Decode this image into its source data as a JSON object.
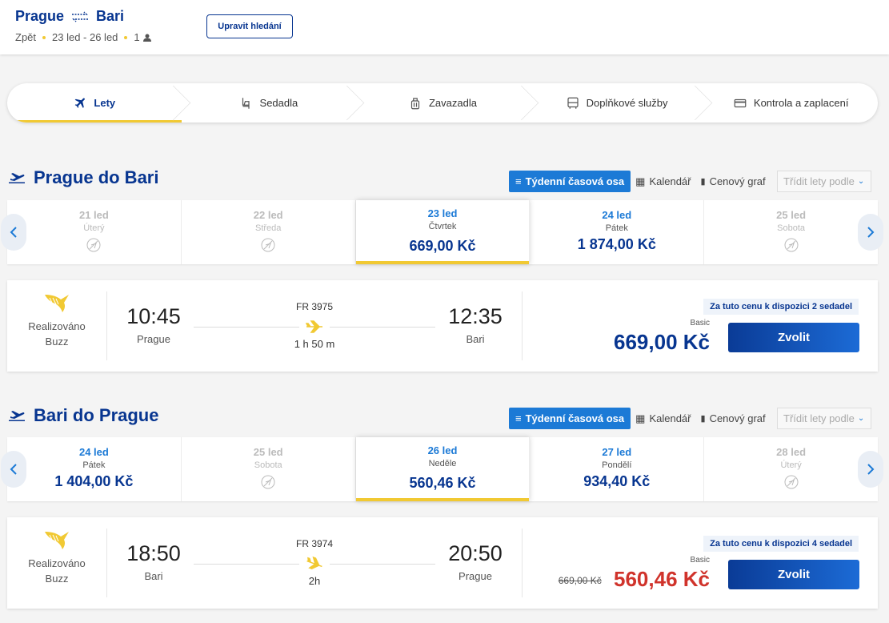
{
  "header": {
    "origin": "Prague",
    "destination": "Bari",
    "trip_type": "Zpět",
    "dates": "23 led - 26 led",
    "passengers": "1",
    "edit_label": "Upravit hledání"
  },
  "steps": [
    {
      "label": "Lety",
      "icon": "plane-icon"
    },
    {
      "label": "Sedadla",
      "icon": "seat-icon"
    },
    {
      "label": "Zavazadla",
      "icon": "luggage-icon"
    },
    {
      "label": "Doplňkové služby",
      "icon": "bus-icon"
    },
    {
      "label": "Kontrola a zaplacení",
      "icon": "card-icon"
    }
  ],
  "view_tabs": {
    "weekly": "Týdenní časová osa",
    "calendar": "Kalendář",
    "price_graph": "Cenový graf",
    "sort": "Třídit lety podle"
  },
  "outbound": {
    "title": "Prague do Bari",
    "dates": [
      {
        "date": "21 led",
        "day": "Úterý",
        "price": null,
        "available": false
      },
      {
        "date": "22 led",
        "day": "Středa",
        "price": null,
        "available": false
      },
      {
        "date": "23 led",
        "day": "Čtvrtek",
        "price": "669,00 Kč",
        "available": true,
        "selected": true
      },
      {
        "date": "24 led",
        "day": "Pátek",
        "price": "1 874,00 Kč",
        "available": true
      },
      {
        "date": "25 led",
        "day": "Sobota",
        "price": null,
        "available": false
      }
    ],
    "flight": {
      "operator": "Realizováno Buzz",
      "depart_time": "10:45",
      "depart_city": "Prague",
      "flight_number": "FR 3975",
      "duration": "1 h 50 m",
      "arrive_time": "12:35",
      "arrive_city": "Bari",
      "seats_note": "Za tuto cenu k dispozici 2 sedadel",
      "fare": "Basic",
      "old_price": "",
      "price": "669,00 Kč",
      "choose_label": "Zvolit"
    }
  },
  "inbound": {
    "title": "Bari do Prague",
    "dates": [
      {
        "date": "24 led",
        "day": "Pátek",
        "price": "1 404,00 Kč",
        "available": true
      },
      {
        "date": "25 led",
        "day": "Sobota",
        "price": null,
        "available": false
      },
      {
        "date": "26 led",
        "day": "Neděle",
        "price": "560,46 Kč",
        "available": true,
        "selected": true
      },
      {
        "date": "27 led",
        "day": "Pondělí",
        "price": "934,40 Kč",
        "available": true
      },
      {
        "date": "28 led",
        "day": "Úterý",
        "price": null,
        "available": false
      }
    ],
    "flight": {
      "operator": "Realizováno Buzz",
      "depart_time": "18:50",
      "depart_city": "Bari",
      "flight_number": "FR 3974",
      "duration": "2h",
      "arrive_time": "20:50",
      "arrive_city": "Prague",
      "seats_note": "Za tuto cenu k dispozici 4 sedadel",
      "fare": "Basic",
      "old_price": "669,00 Kč",
      "price": "560,46 Kč",
      "choose_label": "Zvolit"
    }
  },
  "colors": {
    "brand_blue": "#073590",
    "accent_blue": "#1c7ad6",
    "yellow": "#f1c933",
    "sale_red": "#d0332b"
  }
}
